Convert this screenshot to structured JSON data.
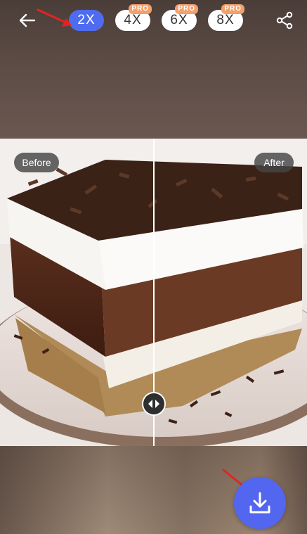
{
  "toolbar": {
    "back_icon": "arrow-left-icon",
    "scales": [
      {
        "label": "2X",
        "active": true,
        "pro": false
      },
      {
        "label": "4X",
        "active": false,
        "pro": true
      },
      {
        "label": "6X",
        "active": false,
        "pro": true
      },
      {
        "label": "8X",
        "active": false,
        "pro": true
      }
    ],
    "pro_label": "PRO",
    "share_icon": "share-icon"
  },
  "compare": {
    "before_label": "Before",
    "after_label": "After",
    "handle_icon": "left-right-arrows-icon"
  },
  "download": {
    "icon": "download-icon"
  },
  "colors": {
    "accent": "#4f6cf0",
    "pro_badge": "#f3a06a",
    "annotation_arrow": "#e52222"
  }
}
